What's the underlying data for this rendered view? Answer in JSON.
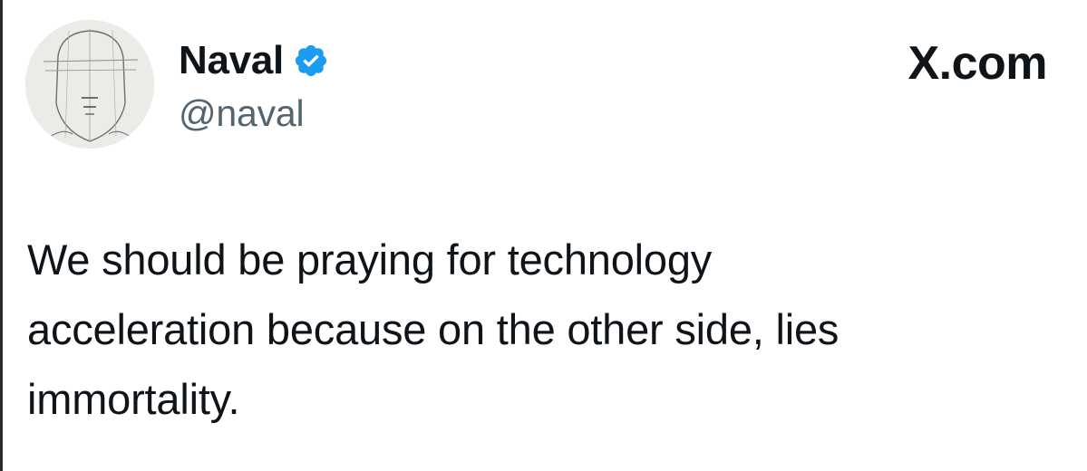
{
  "author": {
    "display_name": "Naval",
    "handle": "@naval",
    "verified_icon": "verified-badge-icon",
    "avatar": "pencil-sketch-face-avatar"
  },
  "brand": {
    "label": "X.com"
  },
  "tweet": {
    "lines": [
      "We should be praying for technology",
      "acceleration because on the other side, lies",
      "immortality."
    ]
  },
  "colors": {
    "text_primary": "#0f1419",
    "text_secondary": "#536471",
    "verified_blue": "#1d9bf0",
    "background": "#ffffff"
  }
}
